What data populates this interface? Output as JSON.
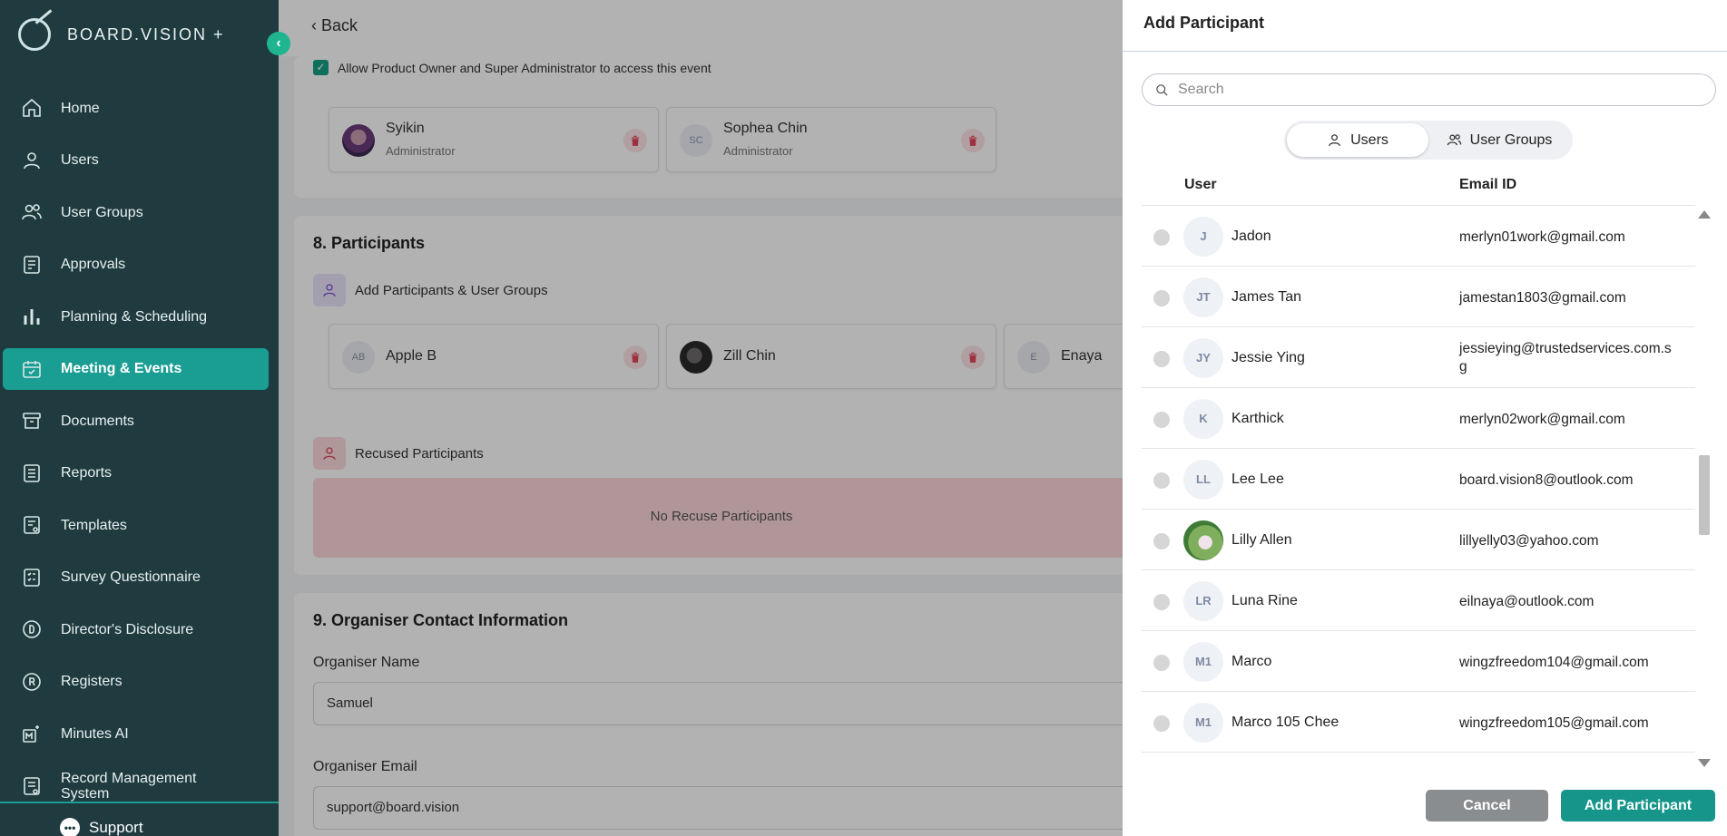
{
  "sidebar": {
    "brand": "BOARD.VISION +",
    "collapse_icon": "chevron-left-icon",
    "items": [
      {
        "label": "Home",
        "icon": "home-icon",
        "active": false
      },
      {
        "label": "Users",
        "icon": "user-icon",
        "active": false
      },
      {
        "label": "User Groups",
        "icon": "users-icon",
        "active": false
      },
      {
        "label": "Approvals",
        "icon": "approvals-icon",
        "active": false
      },
      {
        "label": "Planning & Scheduling",
        "icon": "bar-chart-icon",
        "active": false
      },
      {
        "label": "Meeting & Events",
        "icon": "calendar-icon",
        "active": true
      },
      {
        "label": "Documents",
        "icon": "archive-icon",
        "active": false
      },
      {
        "label": "Reports",
        "icon": "list-icon",
        "active": false
      },
      {
        "label": "Templates",
        "icon": "template-icon",
        "active": false
      },
      {
        "label": "Survey Questionnaire",
        "icon": "survey-icon",
        "active": false
      },
      {
        "label": "Director's Disclosure",
        "icon": "d-circle-icon",
        "active": false
      },
      {
        "label": "Registers",
        "icon": "r-circle-icon",
        "active": false
      },
      {
        "label": "Minutes AI",
        "icon": "minutes-ai-icon",
        "active": false
      },
      {
        "label": "Record Management System",
        "icon": "record-icon",
        "active": false
      }
    ],
    "support": "Support"
  },
  "main": {
    "back": "Back",
    "allow_access": "Allow Product Owner and Super Administrator to access this event",
    "admins": [
      {
        "name": "Syikin",
        "role": "Administrator",
        "initials": ""
      },
      {
        "name": "Sophea Chin",
        "role": "Administrator",
        "initials": "SC"
      }
    ],
    "participants_title": "8. Participants",
    "add_participants": "Add Participants & User Groups",
    "participants": [
      {
        "name": "Apple B",
        "initials": "AB"
      },
      {
        "name": "Zill Chin",
        "initials": ""
      },
      {
        "name": "Enaya",
        "initials": "E"
      }
    ],
    "recused_label": "Recused Participants",
    "no_recuse": "No Recuse Participants",
    "organiser_title": "9. Organiser Contact Information",
    "organiser_name_label": "Organiser Name",
    "organiser_name": "Samuel",
    "organiser_email_label": "Organiser Email",
    "organiser_email": "support@board.vision"
  },
  "panel": {
    "title": "Add Participant",
    "search_placeholder": "Search",
    "tabs": {
      "users": "Users",
      "groups": "User Groups",
      "active": "users"
    },
    "columns": {
      "user": "User",
      "email": "Email ID"
    },
    "rows": [
      {
        "initials": "J",
        "name": "Jadon",
        "email": "merlyn01work@gmail.com"
      },
      {
        "initials": "JT",
        "name": "James Tan",
        "email": "jamestan1803@gmail.com"
      },
      {
        "initials": "JY",
        "name": "Jessie Ying",
        "email": "jessieying@trustedservices.com.sg"
      },
      {
        "initials": "K",
        "name": "Karthick",
        "email": "merlyn02work@gmail.com"
      },
      {
        "initials": "LL",
        "name": "Lee Lee",
        "email": "board.vision8@outlook.com"
      },
      {
        "initials": "",
        "name": "Lilly Allen",
        "email": "lillyelly03@yahoo.com"
      },
      {
        "initials": "LR",
        "name": "Luna Rine",
        "email": "eilnaya@outlook.com"
      },
      {
        "initials": "M1",
        "name": "Marco",
        "email": "wingzfreedom104@gmail.com"
      },
      {
        "initials": "M1",
        "name": "Marco 105 Chee",
        "email": "wingzfreedom105@gmail.com"
      }
    ],
    "cancel": "Cancel",
    "add": "Add Participant"
  },
  "colors": {
    "sidebar_bg": "#1f3b3f",
    "accent": "#1a9d93",
    "delete": "#e0455a",
    "cancel_bg": "#8a8d8f"
  }
}
